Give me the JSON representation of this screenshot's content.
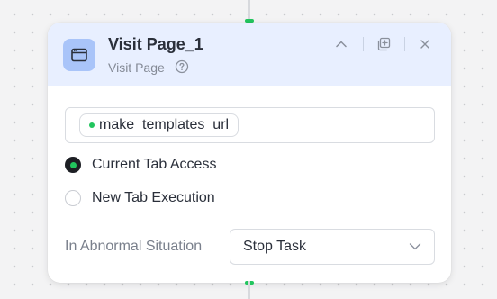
{
  "node": {
    "title": "Visit Page_1",
    "subtitle": "Visit Page",
    "header_bg": "#e8efff",
    "icon_bg": "#a9c4f9",
    "accent": "#22c55e",
    "icons": {
      "node_icon": "browser-window-icon",
      "help": "question-circle-icon",
      "collapse": "chevron-up-icon",
      "duplicate": "copy-plus-icon",
      "close": "close-icon"
    }
  },
  "url_param": {
    "chip_label": "make_templates_url"
  },
  "tab_mode": {
    "options": [
      {
        "label": "Current Tab Access",
        "selected": true
      },
      {
        "label": "New Tab Execution",
        "selected": false
      }
    ]
  },
  "abnormal": {
    "label": "In Abnormal Situation",
    "selected_value": "Stop Task"
  }
}
